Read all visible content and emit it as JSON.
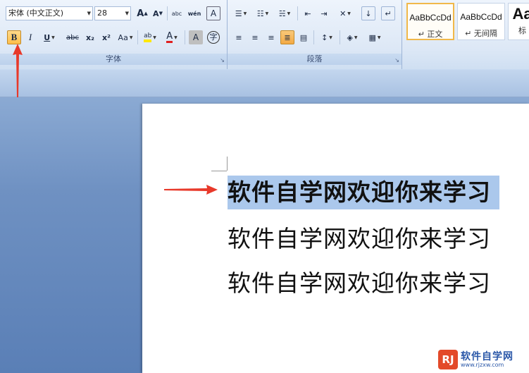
{
  "font_group": {
    "label": "字体",
    "font_name": "宋体 (中文正文)",
    "font_size": "28",
    "grow_font": "A",
    "shrink_font": "A",
    "clear_format": "abc",
    "phonetic": "wén",
    "char_border": "A",
    "bold": "B",
    "italic": "I",
    "underline": "U",
    "strikethrough": "abc",
    "subscript": "x₂",
    "superscript": "x²",
    "change_case": "Aa",
    "highlight": "ab",
    "font_color": "A",
    "char_shading": "A",
    "enclose": "字"
  },
  "paragraph_group": {
    "label": "段落"
  },
  "styles_group": {
    "tiles": [
      {
        "sample": "AaBbCcDd",
        "name": "↵ 正文"
      },
      {
        "sample": "AaBbCcDd",
        "name": "↵ 无间隔"
      },
      {
        "sample": "Aa",
        "name": "标"
      }
    ]
  },
  "document": {
    "lines": [
      "软件自学网欢迎你来学习",
      "软件自学网欢迎你来学习",
      "软件自学网欢迎你来学习"
    ]
  },
  "watermark": {
    "brand": "软件自学网",
    "url": "www.rjzxw.com",
    "logo_text": "RJ"
  },
  "colors": {
    "selection": "#abc8ec",
    "active_button": "#ffbf4a",
    "annotation_arrow": "#e8392a"
  }
}
